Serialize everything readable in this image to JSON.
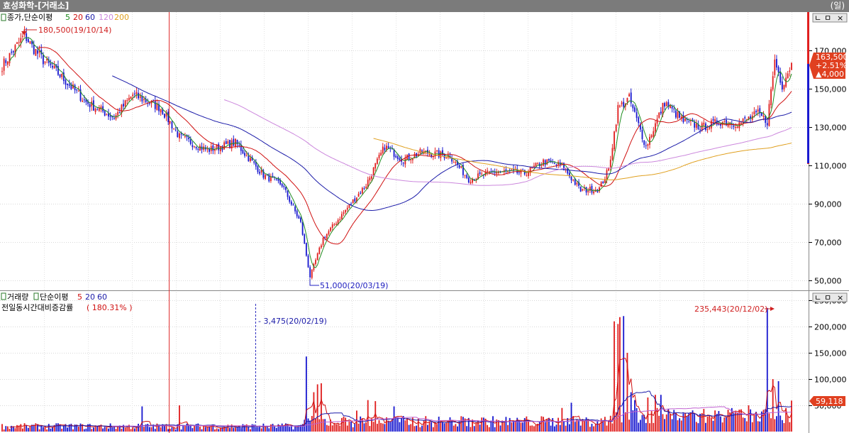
{
  "window": {
    "title": "효성화학-[거래소]",
    "period": "(일)"
  },
  "price_panel": {
    "legend_prefix": "종가,단순이평",
    "ma": [
      {
        "label": "5",
        "color": "#1f8c1f"
      },
      {
        "label": "20",
        "color": "#d01010"
      },
      {
        "label": "60",
        "color": "#1a1aa8"
      },
      {
        "label": "120",
        "color": "#cc88dd"
      },
      {
        "label": "200",
        "color": "#e0a020"
      }
    ],
    "high_note": "180,500(19/10/14)",
    "low_note": "51,000(20/03/19)",
    "current": {
      "price": "163,500",
      "change_pct": "+2.51%",
      "change": "▲4,000"
    },
    "win_buttons": [
      "ㄴ",
      "ㅁ",
      "×"
    ]
  },
  "volume_panel": {
    "legend_prefix": "거래량",
    "legend_ma_prefix": "단순이평",
    "ma": [
      {
        "label": "5",
        "color": "#d01010"
      },
      {
        "label": "20",
        "color": "#1a1aa8"
      },
      {
        "label": "60",
        "color": "#1a1aa8"
      }
    ],
    "ratio_label": "전일동시간대비증감률",
    "ratio_value": "( 180.31% )",
    "cursor_note": "- 3,475(20/02/19)",
    "max_note": "235,443(20/12/02)",
    "current_volume": "59,118",
    "win_buttons": [
      "ㄴ",
      "ㅁ",
      "×"
    ]
  },
  "chart_data": [
    {
      "type": "candlestick",
      "title": "",
      "ylim": [
        45000,
        190000
      ],
      "y_ticks": [
        "170,000",
        "150,000",
        "130,000",
        "110,000",
        "90,000",
        "70,000",
        "50,000"
      ],
      "y_tick_values": [
        170000,
        150000,
        130000,
        110000,
        90000,
        70000,
        50000
      ],
      "anchors": [
        {
          "i": 0,
          "v": 162000
        },
        {
          "i": 12,
          "v": 178000
        },
        {
          "i": 16,
          "v": 172000
        },
        {
          "i": 22,
          "v": 165000
        },
        {
          "i": 30,
          "v": 158000
        },
        {
          "i": 45,
          "v": 143000
        },
        {
          "i": 60,
          "v": 135000
        },
        {
          "i": 70,
          "v": 147000
        },
        {
          "i": 85,
          "v": 140000
        },
        {
          "i": 95,
          "v": 125000
        },
        {
          "i": 110,
          "v": 118000
        },
        {
          "i": 125,
          "v": 122000
        },
        {
          "i": 140,
          "v": 105000
        },
        {
          "i": 150,
          "v": 100000
        },
        {
          "i": 160,
          "v": 80000
        },
        {
          "i": 165,
          "v": 52000
        },
        {
          "i": 172,
          "v": 72000
        },
        {
          "i": 185,
          "v": 88000
        },
        {
          "i": 195,
          "v": 100000
        },
        {
          "i": 205,
          "v": 120000
        },
        {
          "i": 215,
          "v": 113000
        },
        {
          "i": 225,
          "v": 117000
        },
        {
          "i": 240,
          "v": 115000
        },
        {
          "i": 250,
          "v": 103000
        },
        {
          "i": 265,
          "v": 107000
        },
        {
          "i": 280,
          "v": 106000
        },
        {
          "i": 290,
          "v": 112000
        },
        {
          "i": 300,
          "v": 110000
        },
        {
          "i": 310,
          "v": 97000
        },
        {
          "i": 320,
          "v": 98000
        },
        {
          "i": 325,
          "v": 108000
        },
        {
          "i": 330,
          "v": 140000
        },
        {
          "i": 336,
          "v": 145000
        },
        {
          "i": 345,
          "v": 120000
        },
        {
          "i": 355,
          "v": 143000
        },
        {
          "i": 365,
          "v": 133000
        },
        {
          "i": 375,
          "v": 130000
        },
        {
          "i": 385,
          "v": 133000
        },
        {
          "i": 395,
          "v": 132000
        },
        {
          "i": 405,
          "v": 137000
        },
        {
          "i": 410,
          "v": 133000
        },
        {
          "i": 414,
          "v": 165000
        },
        {
          "i": 418,
          "v": 152000
        },
        {
          "i": 423,
          "v": 163500
        }
      ],
      "count": 424,
      "last": 163500
    },
    {
      "type": "bar",
      "title": "",
      "ylim": [
        0,
        265000
      ],
      "y_ticks": [
        "250,000",
        "200,000",
        "150,000",
        "100,000",
        "50,000"
      ],
      "y_tick_values": [
        250000,
        200000,
        150000,
        100000,
        50000
      ],
      "spikes": [
        {
          "i": 75,
          "v": 48000
        },
        {
          "i": 95,
          "v": 50000
        },
        {
          "i": 163,
          "v": 143000
        },
        {
          "i": 167,
          "v": 75000
        },
        {
          "i": 169,
          "v": 90000
        },
        {
          "i": 171,
          "v": 92000
        },
        {
          "i": 190,
          "v": 40000
        },
        {
          "i": 196,
          "v": 60000
        },
        {
          "i": 200,
          "v": 58000
        },
        {
          "i": 210,
          "v": 48000
        },
        {
          "i": 300,
          "v": 45000
        },
        {
          "i": 305,
          "v": 55000
        },
        {
          "i": 328,
          "v": 210000
        },
        {
          "i": 330,
          "v": 205000
        },
        {
          "i": 331,
          "v": 218000
        },
        {
          "i": 333,
          "v": 220000
        },
        {
          "i": 335,
          "v": 150000
        },
        {
          "i": 337,
          "v": 75000
        },
        {
          "i": 339,
          "v": 60000
        },
        {
          "i": 346,
          "v": 65000
        },
        {
          "i": 350,
          "v": 70000
        },
        {
          "i": 353,
          "v": 70000
        },
        {
          "i": 400,
          "v": 50000
        },
        {
          "i": 410,
          "v": 235443
        },
        {
          "i": 413,
          "v": 100000
        },
        {
          "i": 416,
          "v": 96000
        },
        {
          "i": 420,
          "v": 45000
        },
        {
          "i": 423,
          "v": 59118
        }
      ],
      "count": 424,
      "last": 59118
    }
  ]
}
